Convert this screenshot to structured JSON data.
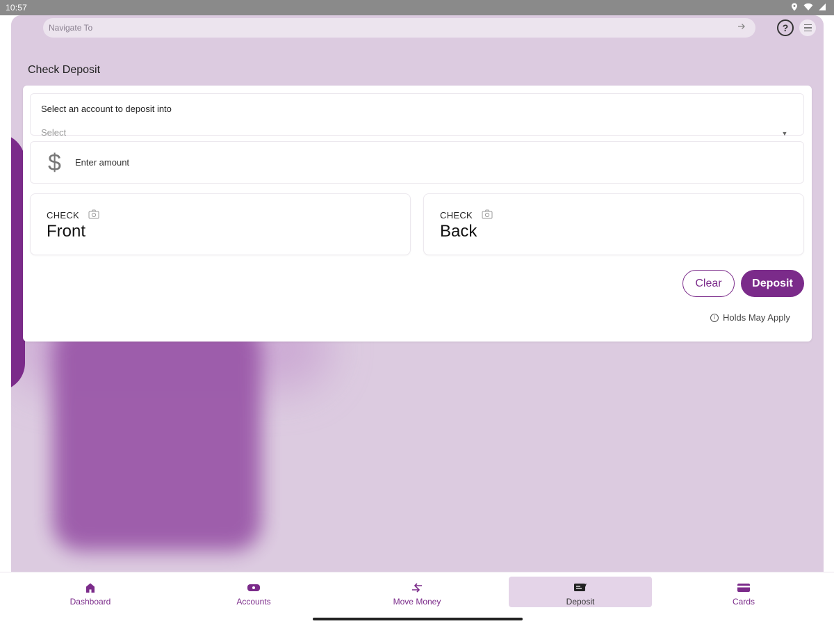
{
  "status_bar": {
    "time": "10:57"
  },
  "navigate": {
    "placeholder": "Navigate To"
  },
  "page": {
    "title": "Check Deposit"
  },
  "deposit_form": {
    "account_label": "Select an account to deposit into",
    "account_select_value": "Select",
    "amount_placeholder": "Enter amount",
    "check_front": {
      "small": "CHECK",
      "big": "Front"
    },
    "check_back": {
      "small": "CHECK",
      "big": "Back"
    },
    "clear_label": "Clear",
    "deposit_label": "Deposit",
    "holds_note": "Holds May Apply"
  },
  "bottom_nav": {
    "items": [
      {
        "label": "Dashboard",
        "icon": "home-icon"
      },
      {
        "label": "Accounts",
        "icon": "money-icon"
      },
      {
        "label": "Move Money",
        "icon": "transfer-icon"
      },
      {
        "label": "Deposit",
        "icon": "deposit-check-icon",
        "active": true
      },
      {
        "label": "Cards",
        "icon": "card-icon"
      }
    ]
  },
  "colors": {
    "accent": "#7b2b8a",
    "background": "#dccbe0",
    "active_tab": "#e4d4e8"
  }
}
